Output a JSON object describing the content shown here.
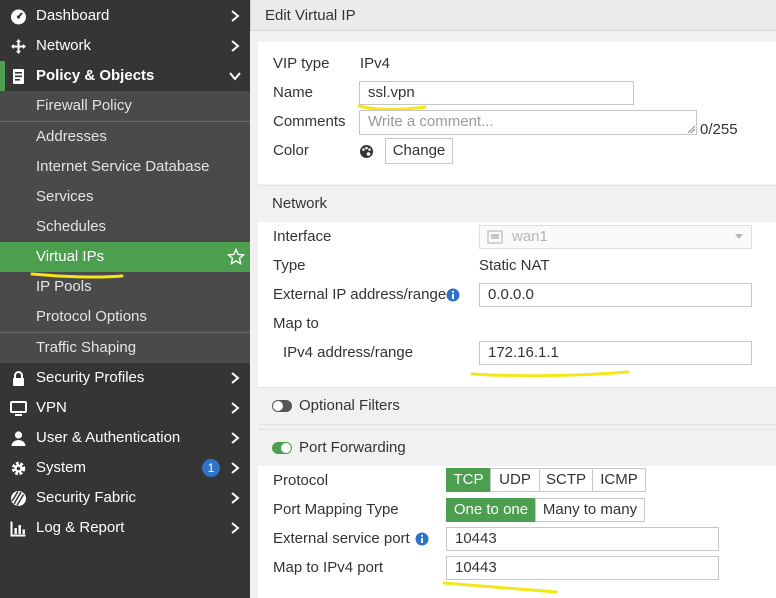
{
  "sidebar": {
    "items": [
      {
        "label": "Dashboard",
        "icon": "dashboard-icon"
      },
      {
        "label": "Network",
        "icon": "network-icon"
      },
      {
        "label": "Policy & Objects",
        "icon": "policy-icon"
      },
      {
        "label": "Security Profiles",
        "icon": "lock-icon"
      },
      {
        "label": "VPN",
        "icon": "monitor-icon"
      },
      {
        "label": "User & Authentication",
        "icon": "user-icon"
      },
      {
        "label": "System",
        "icon": "gear-icon",
        "badge": "1"
      },
      {
        "label": "Security Fabric",
        "icon": "fabric-icon"
      },
      {
        "label": "Log & Report",
        "icon": "chart-icon"
      }
    ],
    "subitems": [
      "Firewall Policy",
      "Addresses",
      "Internet Service Database",
      "Services",
      "Schedules",
      "Virtual IPs",
      "IP Pools",
      "Protocol Options",
      "Traffic Shaping"
    ],
    "active_subitem": "Virtual IPs"
  },
  "page": {
    "title": "Edit Virtual IP"
  },
  "form": {
    "vip_type_label": "VIP type",
    "vip_type_value": "IPv4",
    "name_label": "Name",
    "name_value": "ssl.vpn",
    "comments_label": "Comments",
    "comments_placeholder": "Write a comment...",
    "comments_counter": "0/255",
    "color_label": "Color",
    "color_button": "Change"
  },
  "network": {
    "section_title": "Network",
    "interface_label": "Interface",
    "interface_value": "wan1",
    "type_label": "Type",
    "type_value": "Static NAT",
    "external_ip_label": "External IP address/range",
    "external_ip_value": "0.0.0.0",
    "map_to_label": "Map to",
    "ipv4_range_label": "IPv4 address/range",
    "ipv4_range_value": "172.16.1.1"
  },
  "optional_filters": {
    "label": "Optional Filters",
    "enabled": false
  },
  "port_forwarding": {
    "label": "Port Forwarding",
    "enabled": true,
    "protocol_label": "Protocol",
    "protocols": [
      "TCP",
      "UDP",
      "SCTP",
      "ICMP"
    ],
    "protocol_selected": "TCP",
    "mapping_label": "Port Mapping Type",
    "mapping_options": [
      "One to one",
      "Many to many"
    ],
    "mapping_selected": "One to one",
    "ext_port_label": "External service port",
    "ext_port_value": "10443",
    "map_port_label": "Map to IPv4 port",
    "map_port_value": "10443"
  },
  "colors": {
    "accent": "#4b9f4e",
    "sidebar_bg": "#353535",
    "submenu_bg": "#4a4a4a",
    "highlight": "#f5e61a",
    "badge": "#2d73c7"
  }
}
